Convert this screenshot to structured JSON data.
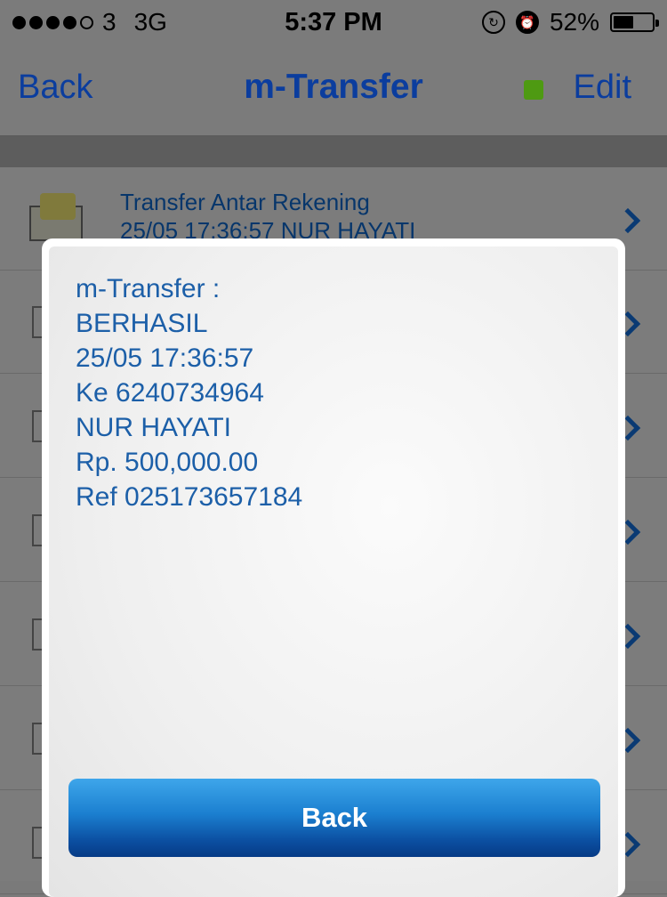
{
  "status_bar": {
    "carrier": "3",
    "network": "3G",
    "time": "5:37 PM",
    "battery": "52%",
    "battery_level": 0.52,
    "signal_bars": 4
  },
  "nav": {
    "back_label": "Back",
    "title": "m-Transfer",
    "edit_label": "Edit",
    "indicator_color": "#4e9a12"
  },
  "list": {
    "first_item": {
      "title": "Transfer Antar Rekening",
      "subtitle": "25/05 17:36:57 NUR HAYATI"
    }
  },
  "dialog": {
    "lines": [
      "m-Transfer :",
      "BERHASIL",
      "25/05 17:36:57",
      "Ke 6240734964",
      "NUR HAYATI",
      "Rp. 500,000.00",
      "Ref 025173657184"
    ],
    "button_label": "Back"
  }
}
